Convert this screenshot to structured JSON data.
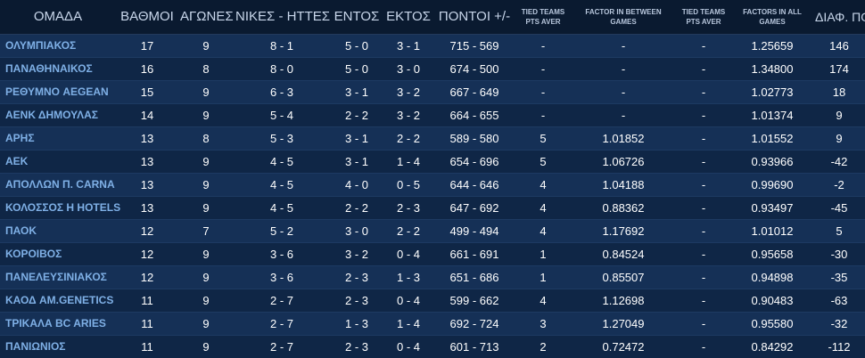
{
  "headers": {
    "team": "ΟΜΑΔΑ",
    "points": "ΒΑΘΜΟΙ",
    "games": "ΑΓΩΝΕΣ",
    "wins_losses": "ΝΙΚΕΣ - ΗΤΤΕΣ",
    "home": "ΕΝΤΟΣ",
    "away": "ΕΚΤΟΣ",
    "score": "ΠΟΝΤΟΙ +/-",
    "tied_pts_aver": "TIED TEAMS PTS AVER",
    "factor_between": "FACTOR IN BETWEEN GAMES",
    "tied_pts_aver2": "TIED TEAMS PTS AVER",
    "factor_all": "FACTORS IN ALL GAMES",
    "diff": "ΔΙΑΦ. ΠΟΝΤΩΝ"
  },
  "rows": [
    {
      "team": "ΟΛΥΜΠΙΑΚΟΣ",
      "points": "17",
      "games": "9",
      "wl": "8 - 1",
      "home": "5 - 0",
      "away": "3 - 1",
      "score": "715 - 569",
      "tied": "-",
      "factor_between": "-",
      "tied2": "-",
      "factor_all": "1.25659",
      "diff": "146"
    },
    {
      "team": "ΠΑΝΑΘΗΝΑΙΚΟΣ",
      "points": "16",
      "games": "8",
      "wl": "8 - 0",
      "home": "5 - 0",
      "away": "3 - 0",
      "score": "674 - 500",
      "tied": "-",
      "factor_between": "-",
      "tied2": "-",
      "factor_all": "1.34800",
      "diff": "174"
    },
    {
      "team": "ΡΕΘΥΜΝΟ AEGEAN",
      "points": "15",
      "games": "9",
      "wl": "6 - 3",
      "home": "3 - 1",
      "away": "3 - 2",
      "score": "667 - 649",
      "tied": "-",
      "factor_between": "-",
      "tied2": "-",
      "factor_all": "1.02773",
      "diff": "18"
    },
    {
      "team": "ΑΕΝΚ ΔΗΜΟΥΛΑΣ",
      "points": "14",
      "games": "9",
      "wl": "5 - 4",
      "home": "2 - 2",
      "away": "3 - 2",
      "score": "664 - 655",
      "tied": "-",
      "factor_between": "-",
      "tied2": "-",
      "factor_all": "1.01374",
      "diff": "9"
    },
    {
      "team": "ΑΡΗΣ",
      "points": "13",
      "games": "8",
      "wl": "5 - 3",
      "home": "3 - 1",
      "away": "2 - 2",
      "score": "589 - 580",
      "tied": "5",
      "factor_between": "1.01852",
      "tied2": "-",
      "factor_all": "1.01552",
      "diff": "9"
    },
    {
      "team": "ΑΕΚ",
      "points": "13",
      "games": "9",
      "wl": "4 - 5",
      "home": "3 - 1",
      "away": "1 - 4",
      "score": "654 - 696",
      "tied": "5",
      "factor_between": "1.06726",
      "tied2": "-",
      "factor_all": "0.93966",
      "diff": "-42"
    },
    {
      "team": "ΑΠΟΛΛΩΝ Π. CARNA",
      "points": "13",
      "games": "9",
      "wl": "4 - 5",
      "home": "4 - 0",
      "away": "0 - 5",
      "score": "644 - 646",
      "tied": "4",
      "factor_between": "1.04188",
      "tied2": "-",
      "factor_all": "0.99690",
      "diff": "-2"
    },
    {
      "team": "ΚΟΛΟΣΣΟΣ Η HOTELS",
      "points": "13",
      "games": "9",
      "wl": "4 - 5",
      "home": "2 - 2",
      "away": "2 - 3",
      "score": "647 - 692",
      "tied": "4",
      "factor_between": "0.88362",
      "tied2": "-",
      "factor_all": "0.93497",
      "diff": "-45"
    },
    {
      "team": "ΠΑΟΚ",
      "points": "12",
      "games": "7",
      "wl": "5 - 2",
      "home": "3 - 0",
      "away": "2 - 2",
      "score": "499 - 494",
      "tied": "4",
      "factor_between": "1.17692",
      "tied2": "-",
      "factor_all": "1.01012",
      "diff": "5"
    },
    {
      "team": "ΚΟΡΟΙΒΟΣ",
      "points": "12",
      "games": "9",
      "wl": "3 - 6",
      "home": "3 - 2",
      "away": "0 - 4",
      "score": "661 - 691",
      "tied": "1",
      "factor_between": "0.84524",
      "tied2": "-",
      "factor_all": "0.95658",
      "diff": "-30"
    },
    {
      "team": "ΠΑΝΕΛΕΥΣΙΝΙΑΚΟΣ",
      "points": "12",
      "games": "9",
      "wl": "3 - 6",
      "home": "2 - 3",
      "away": "1 - 3",
      "score": "651 - 686",
      "tied": "1",
      "factor_between": "0.85507",
      "tied2": "-",
      "factor_all": "0.94898",
      "diff": "-35"
    },
    {
      "team": "ΚΑΟΔ AM.GENETICS",
      "points": "11",
      "games": "9",
      "wl": "2 - 7",
      "home": "2 - 3",
      "away": "0 - 4",
      "score": "599 - 662",
      "tied": "4",
      "factor_between": "1.12698",
      "tied2": "-",
      "factor_all": "0.90483",
      "diff": "-63"
    },
    {
      "team": "ΤΡΙΚΑΛΑ BC ARIES",
      "points": "11",
      "games": "9",
      "wl": "2 - 7",
      "home": "1 - 3",
      "away": "1 - 4",
      "score": "692 - 724",
      "tied": "3",
      "factor_between": "1.27049",
      "tied2": "-",
      "factor_all": "0.95580",
      "diff": "-32"
    },
    {
      "team": "ΠΑΝΙΩΝΙΟΣ",
      "points": "11",
      "games": "9",
      "wl": "2 - 7",
      "home": "2 - 3",
      "away": "0 - 4",
      "score": "601 - 713",
      "tied": "2",
      "factor_between": "0.72472",
      "tied2": "-",
      "factor_all": "0.84292",
      "diff": "-112"
    }
  ]
}
